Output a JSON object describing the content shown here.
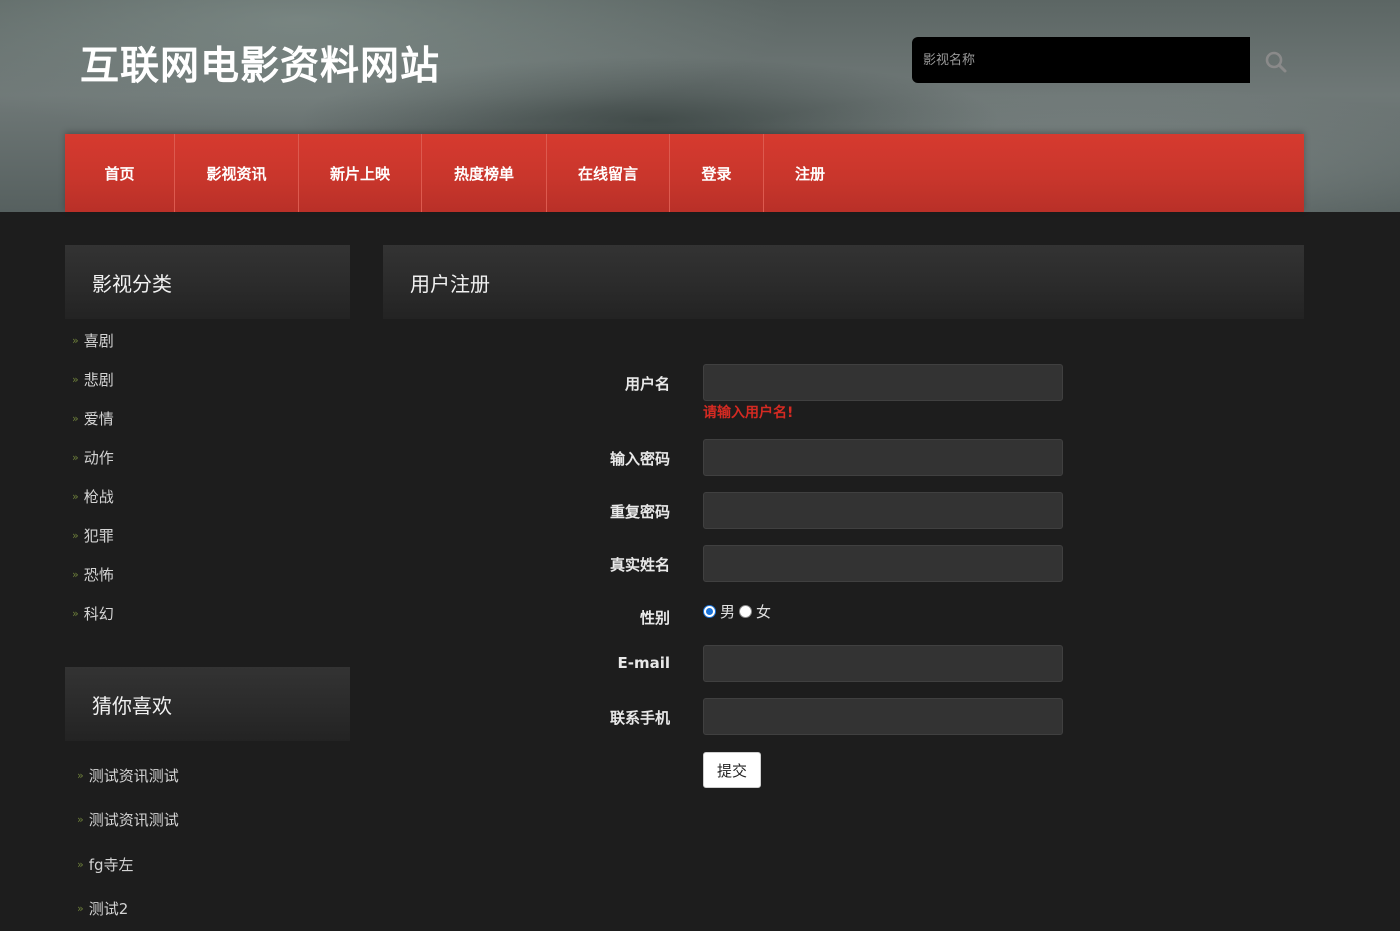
{
  "header": {
    "site_title": "互联网电影资料网站",
    "search_placeholder": "影视名称"
  },
  "nav": {
    "items": [
      "首页",
      "影视资讯",
      "新片上映",
      "热度榜单",
      "在线留言",
      "登录",
      "注册"
    ]
  },
  "sidebar": {
    "categories_title": "影视分类",
    "categories": [
      "喜剧",
      "悲剧",
      "爱情",
      "动作",
      "枪战",
      "犯罪",
      "恐怖",
      "科幻"
    ],
    "likes_title": "猜你喜欢",
    "likes": [
      "测试资讯测试",
      "测试资讯测试",
      "fg寺左",
      "测试2"
    ]
  },
  "form": {
    "title": "用户注册",
    "username_label": "用户名",
    "username_error": "请输入用户名!",
    "password_label": "输入密码",
    "repeat_password_label": "重复密码",
    "real_name_label": "真实姓名",
    "gender_label": "性别",
    "gender_male": "男",
    "gender_female": "女",
    "email_label": "E-mail",
    "phone_label": "联系手机",
    "submit_label": "提交"
  },
  "colors": {
    "nav_red": "#c9362c",
    "error_red": "#d42a22",
    "radio_blue": "#1a73d9"
  }
}
